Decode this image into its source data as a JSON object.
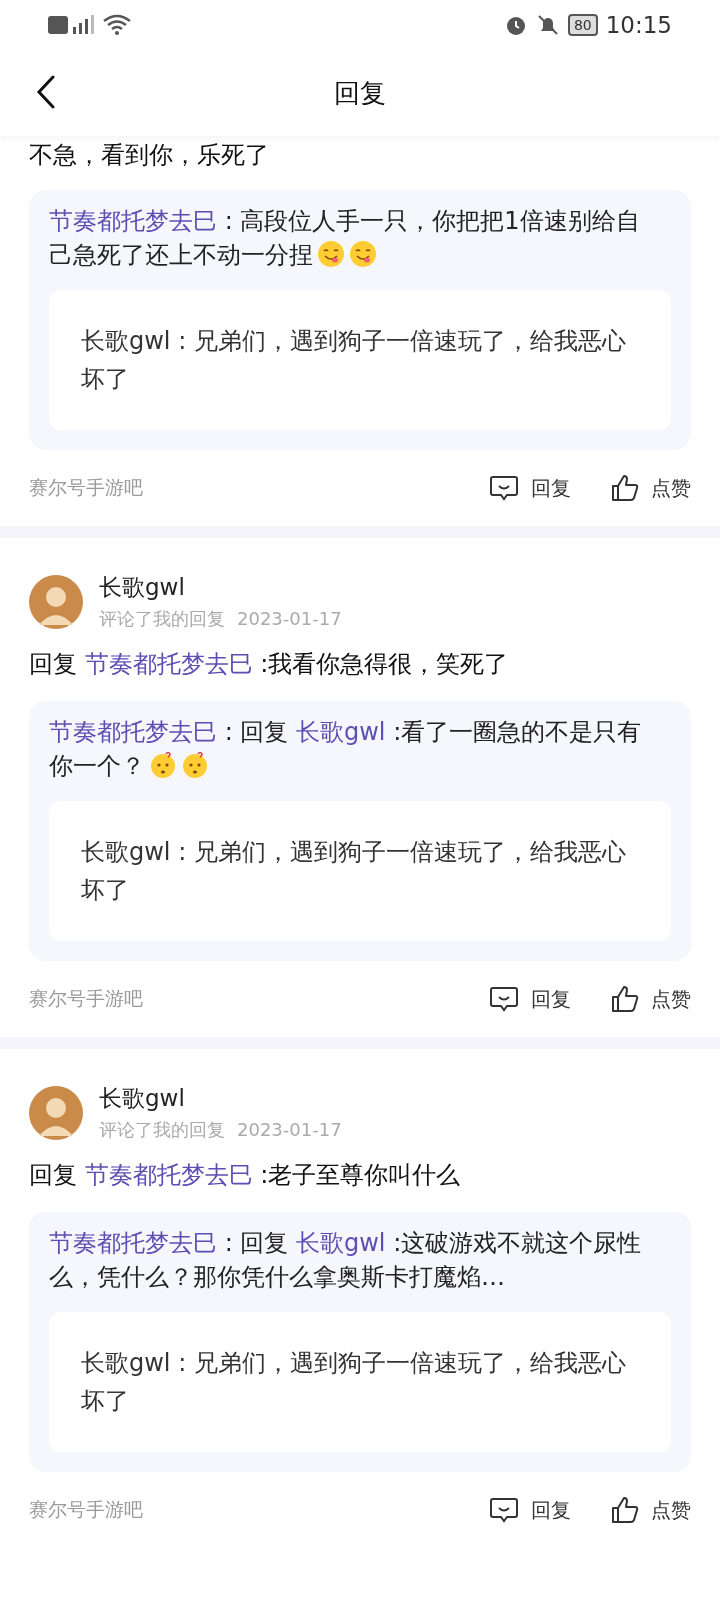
{
  "status_bar": {
    "time": "10:15",
    "battery": "80"
  },
  "header": {
    "title": "回复"
  },
  "posts": [
    {
      "reply_text": "不急，看到你，乐死了",
      "quote": {
        "author": "节奏都托梦去巳",
        "text": " : 高段位人手一只，你把把1倍速别给自己急死了还上不动一分捏",
        "emojis": [
          {
            "kind": "savoring"
          },
          {
            "kind": "savoring"
          }
        ],
        "inner": {
          "text": "长歌gwl : 兄弟们，遇到狗子一倍速玩了，给我恶心坏了"
        }
      },
      "forum": "赛尔号手游吧",
      "actions": [
        "回复",
        "点赞"
      ]
    },
    {
      "user": {
        "name": "长歌gwl",
        "action": "评论了我的回复",
        "date": "2023-01-17"
      },
      "reply_prefix": "回复",
      "reply_target": "节奏都托梦去巳",
      "reply_text": ":我看你急得很，笑死了",
      "quote": {
        "author": "节奏都托梦去巳",
        "reply_label": " : 回复",
        "reply_to": "长歌gwl",
        "text": ":看了一圈急的不是只有你一个？",
        "emojis": [
          {
            "kind": "puzzled"
          },
          {
            "kind": "puzzled"
          }
        ],
        "inner": {
          "text": "长歌gwl : 兄弟们，遇到狗子一倍速玩了，给我恶心坏了"
        }
      },
      "forum": "赛尔号手游吧",
      "actions": [
        "回复",
        "点赞"
      ]
    },
    {
      "user": {
        "name": "长歌gwl",
        "action": "评论了我的回复",
        "date": "2023-01-17"
      },
      "reply_prefix": "回复",
      "reply_target": "节奏都托梦去巳",
      "reply_text": ":老子至尊你叫什么",
      "quote": {
        "author": "节奏都托梦去巳",
        "reply_label": " : 回复",
        "reply_to": "长歌gwl",
        "text": ":这破游戏不就这个尿性么，凭什么？那你凭什么拿奥斯卡打魔焰…",
        "inner": {
          "text": "长歌gwl : 兄弟们，遇到狗子一倍速玩了，给我恶心坏了"
        }
      },
      "forum": "赛尔号手游吧",
      "actions": [
        "回复",
        "点赞"
      ]
    }
  ]
}
